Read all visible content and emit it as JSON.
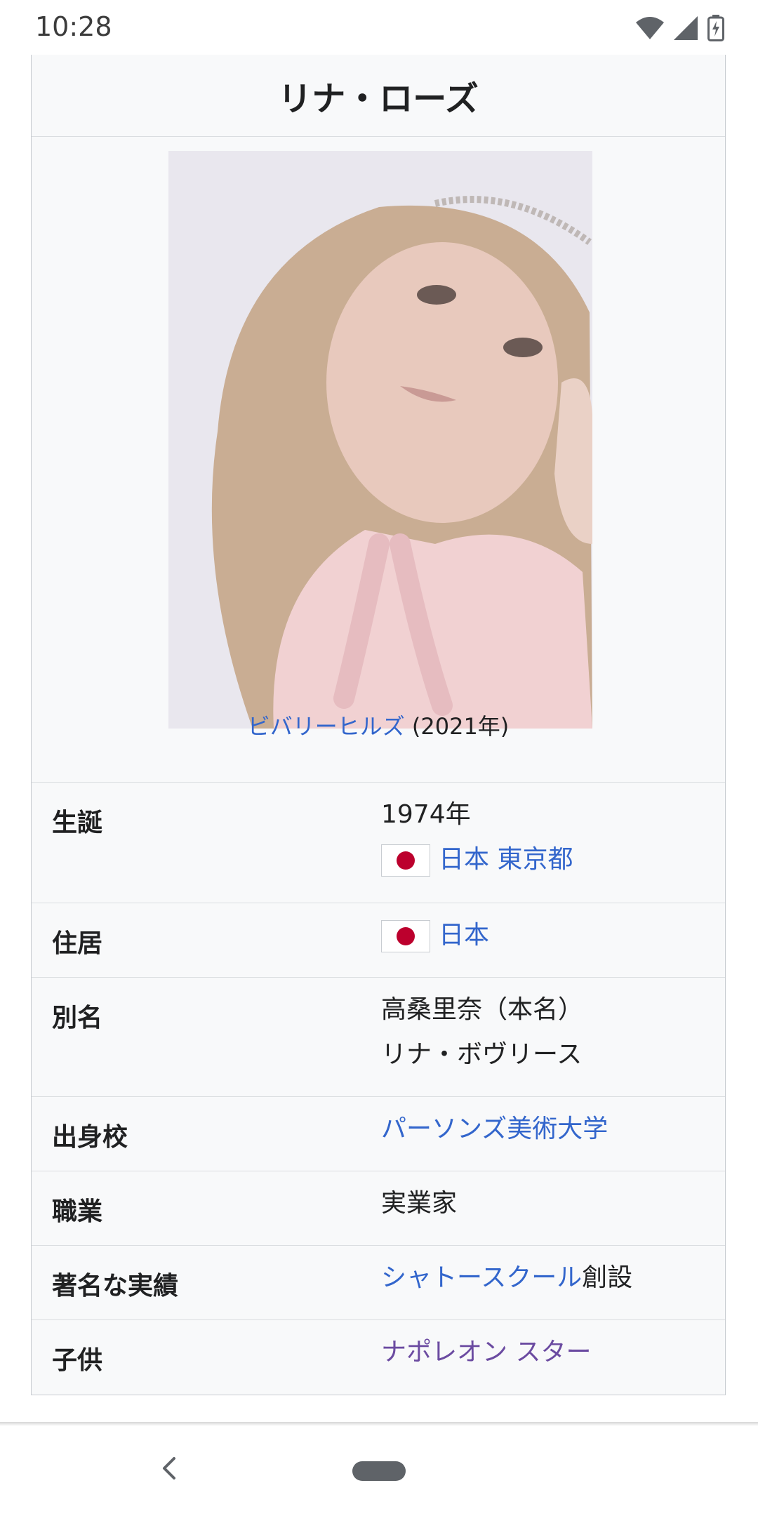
{
  "status_bar": {
    "time": "10:28"
  },
  "infobox": {
    "title": "リナ・ローズ",
    "image": {
      "caption_link": "ビバリーヒルズ",
      "caption_rest": " (2021年)"
    },
    "rows": {
      "birth": {
        "label": "生誕",
        "year": "1974年",
        "country": "日本",
        "city": "東京都"
      },
      "residence": {
        "label": "住居",
        "country": "日本"
      },
      "alias": {
        "label": "別名",
        "line1": "高桑里奈（本名）",
        "line2": "リナ・ボヴリース"
      },
      "alma_mater": {
        "label": "出身校",
        "value": "パーソンズ美術大学"
      },
      "occupation": {
        "label": "職業",
        "value": "実業家"
      },
      "known_for": {
        "label": "著名な実績",
        "link": "シャトースクール",
        "suffix": "創設"
      },
      "children": {
        "label": "子供",
        "value": "ナポレオン スター"
      }
    }
  },
  "colors": {
    "link": "#3366cc",
    "visited_link": "#6b4ba1",
    "flag_red": "#bc002d"
  }
}
